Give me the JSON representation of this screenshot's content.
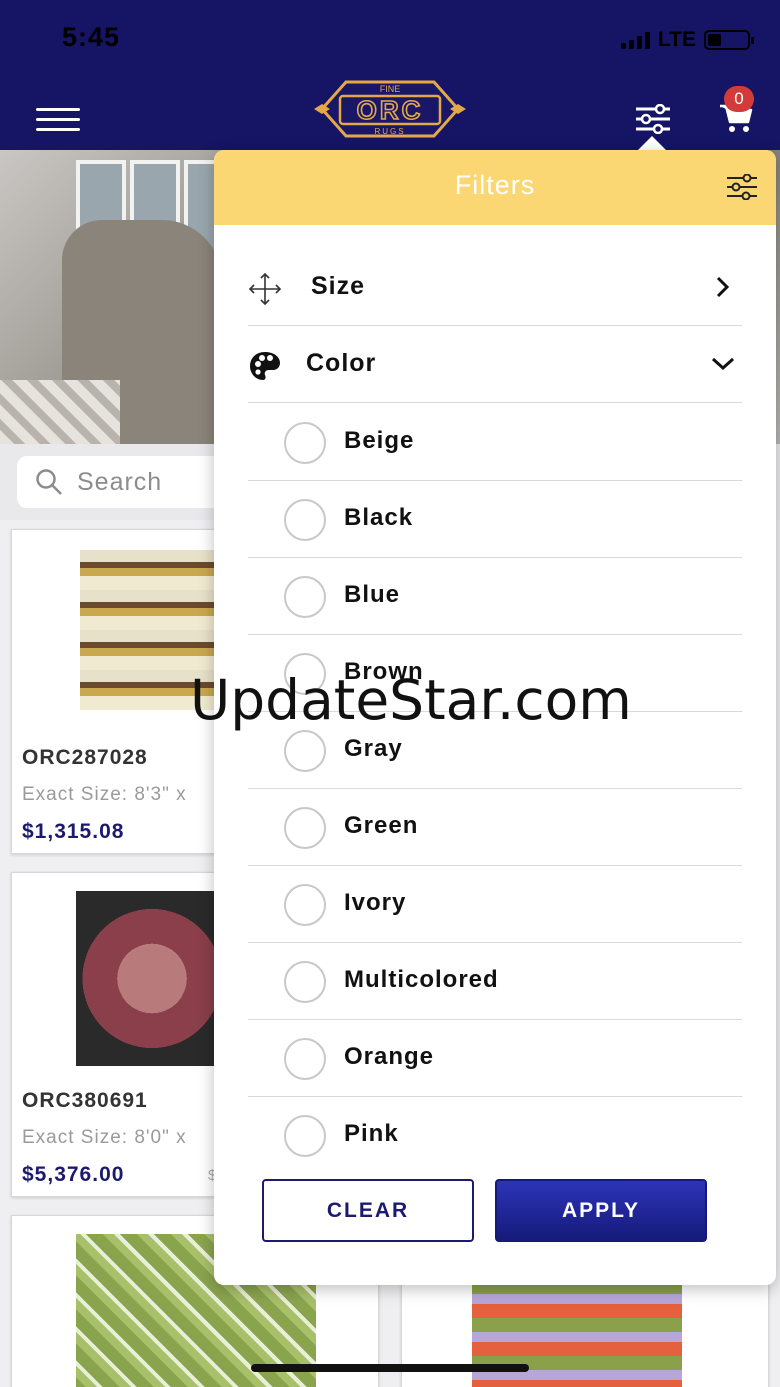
{
  "status_bar": {
    "time": "5:45",
    "network": "LTE"
  },
  "header": {
    "logo": {
      "top": "FINE",
      "main": "ORC",
      "bottom": "RUGS"
    },
    "cart_count": "0",
    "icons": [
      "menu-icon",
      "sliders-icon",
      "cart-icon"
    ],
    "bg_color": "#161464"
  },
  "search": {
    "placeholder": "Search"
  },
  "products": [
    {
      "code": "ORC287028",
      "size": "Exact Size: 8'3\" x",
      "price": "$1,315.08",
      "old_price": ""
    },
    {
      "code": "ORC380691",
      "size": "Exact Size: 8'0\" x",
      "price": "$5,376.00",
      "old_price": "$"
    }
  ],
  "filters": {
    "title": "Filters",
    "header_color": "#fbd774",
    "sections": [
      {
        "label": "Size",
        "icon": "move-arrows-icon",
        "state": "collapsed"
      },
      {
        "label": "Color",
        "icon": "palette-icon",
        "state": "expanded"
      }
    ],
    "color_options": [
      "Beige",
      "Black",
      "Blue",
      "Brown",
      "Gray",
      "Green",
      "Ivory",
      "Multicolored",
      "Orange",
      "Pink"
    ],
    "clear_label": "CLEAR",
    "apply_label": "APPLY"
  },
  "watermark": "UpdateStar.com"
}
